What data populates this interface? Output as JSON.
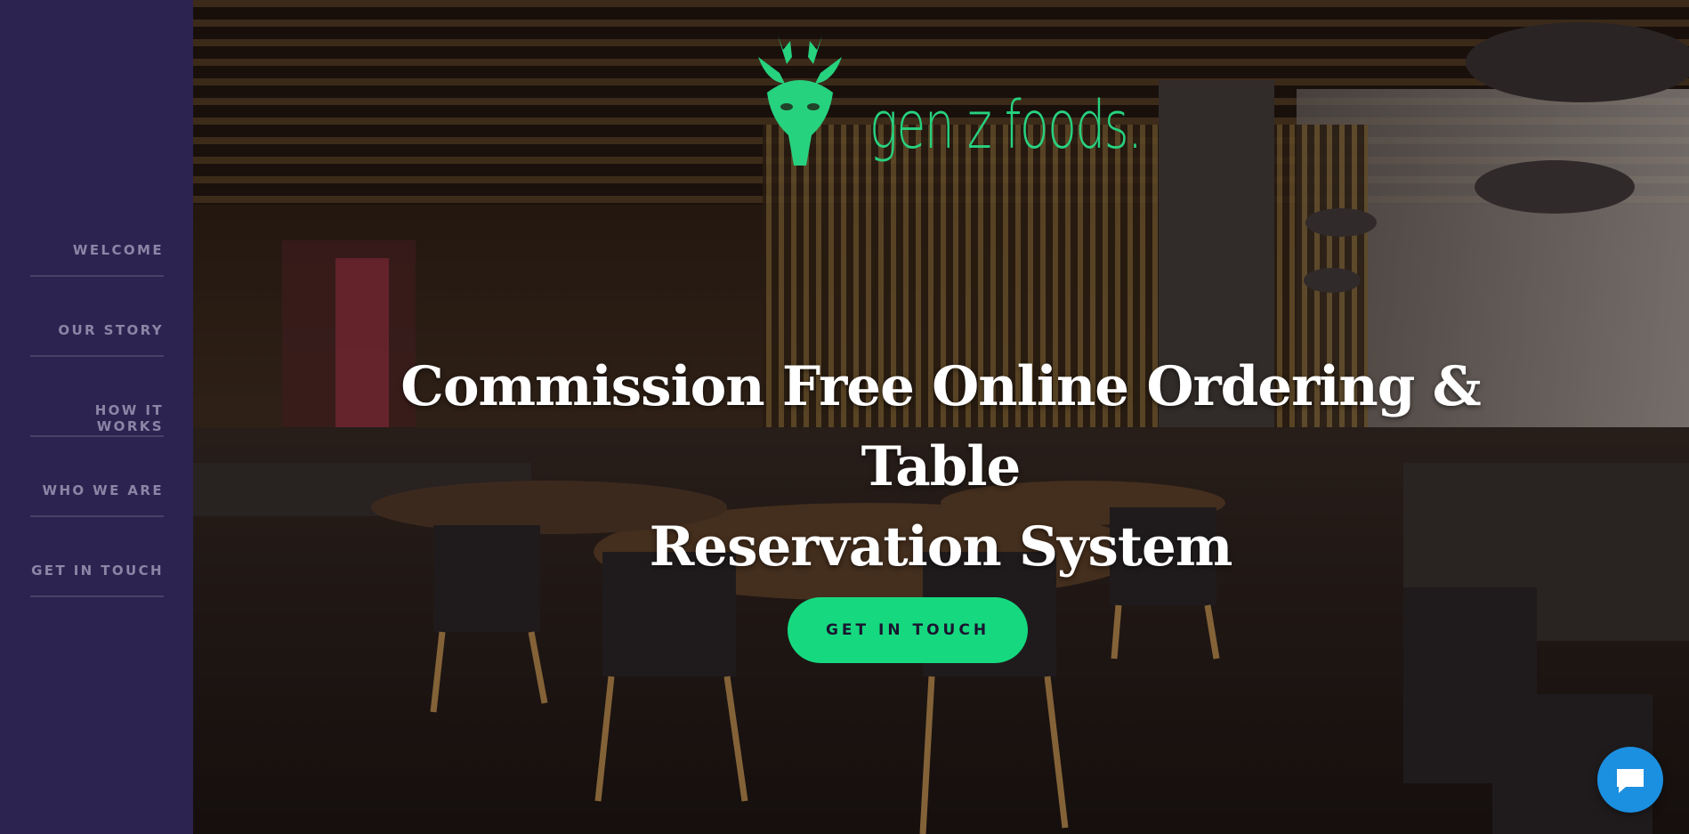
{
  "brand": {
    "name": "gen z foods.",
    "logo_color": "#27d27f"
  },
  "sidebar": {
    "background": "#2d2350",
    "items": [
      {
        "label": "WELCOME"
      },
      {
        "label": "OUR STORY"
      },
      {
        "label": "HOW IT WORKS"
      },
      {
        "label": "WHO WE ARE"
      },
      {
        "label": "GET IN TOUCH"
      }
    ]
  },
  "hero": {
    "headline_line1": "Commission Free Online Ordering & Table",
    "headline_line2": "Reservation System",
    "cta_label": "GET IN TOUCH",
    "cta_color": "#16d97f",
    "background_image": "restaurant-interior"
  },
  "chat_widget": {
    "icon": "chat-bubble-icon",
    "color": "#1b8fe0"
  }
}
